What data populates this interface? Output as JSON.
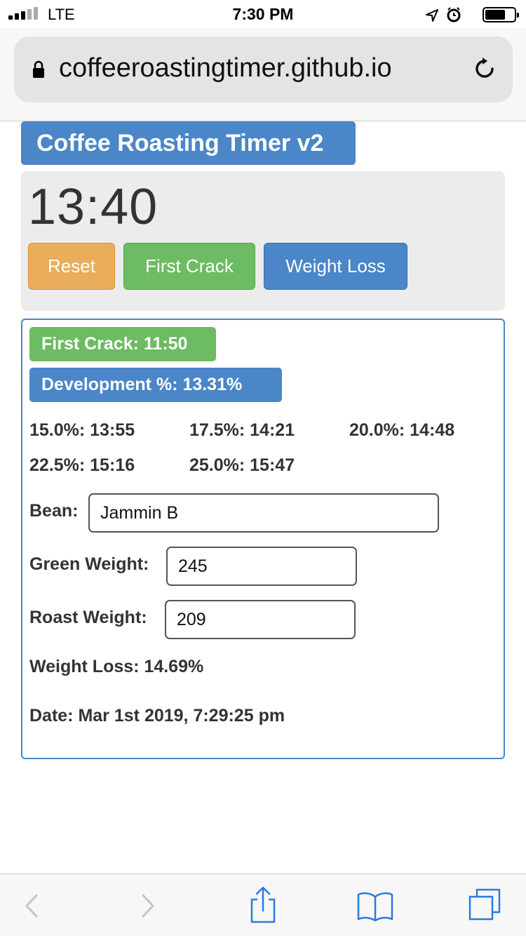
{
  "status_bar": {
    "carrier": "LTE",
    "time": "7:30 PM",
    "signal_bars_filled": 3,
    "signal_bars_total": 5,
    "battery_level": 0.7,
    "icons": [
      "location-icon",
      "alarm-icon",
      "battery-icon"
    ]
  },
  "browser": {
    "url": "coffeeroastingtimer.github.io",
    "icons": [
      "lock-icon",
      "reload-icon"
    ]
  },
  "app": {
    "title": "Coffee Roasting Timer v2",
    "timer": "13:40",
    "buttons": {
      "reset": "Reset",
      "first_crack": "First Crack",
      "weight_loss": "Weight Loss"
    },
    "colors": {
      "primary": "#4a86c8",
      "success": "#6dbb62",
      "warning": "#e9ad5b"
    }
  },
  "results": {
    "first_crack": "First Crack: 11:50",
    "development": "Development %: 13.31%",
    "targets": [
      "15.0%: 13:55",
      "17.5%: 14:21",
      "20.0%: 14:48",
      "22.5%: 15:16",
      "25.0%: 15:47"
    ],
    "bean_label": "Bean:",
    "bean_value": "Jammin B",
    "green_weight_label": "Green Weight:",
    "green_weight_value": "245",
    "roast_weight_label": "Roast Weight:",
    "roast_weight_value": "209",
    "weight_loss": "Weight Loss: 14.69%",
    "date": "Date: Mar 1st 2019, 7:29:25 pm"
  },
  "toolbar": {
    "icons": [
      "back-icon",
      "forward-icon",
      "share-icon",
      "bookmarks-icon",
      "tabs-icon"
    ]
  }
}
